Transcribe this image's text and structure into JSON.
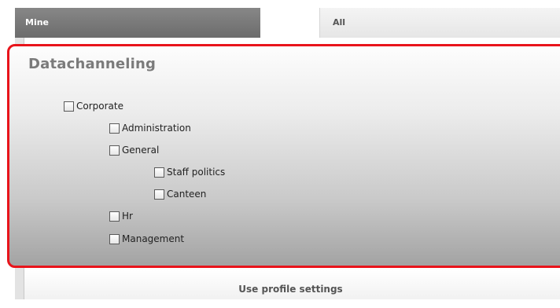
{
  "tabs": {
    "mine_label": "Mine",
    "all_label": "All",
    "active": "Mine"
  },
  "panel": {
    "title": "Datachanneling",
    "highlight_color": "#e8141b"
  },
  "tree": [
    {
      "label": "Corporate",
      "checked": false
    },
    {
      "label": "Administration",
      "checked": false
    },
    {
      "label": "General",
      "checked": false
    },
    {
      "label": "Staff politics",
      "checked": false
    },
    {
      "label": "Canteen",
      "checked": false
    },
    {
      "label": "Hr",
      "checked": false
    },
    {
      "label": "Management",
      "checked": false
    }
  ],
  "footer": {
    "button_label": "Use profile settings"
  }
}
